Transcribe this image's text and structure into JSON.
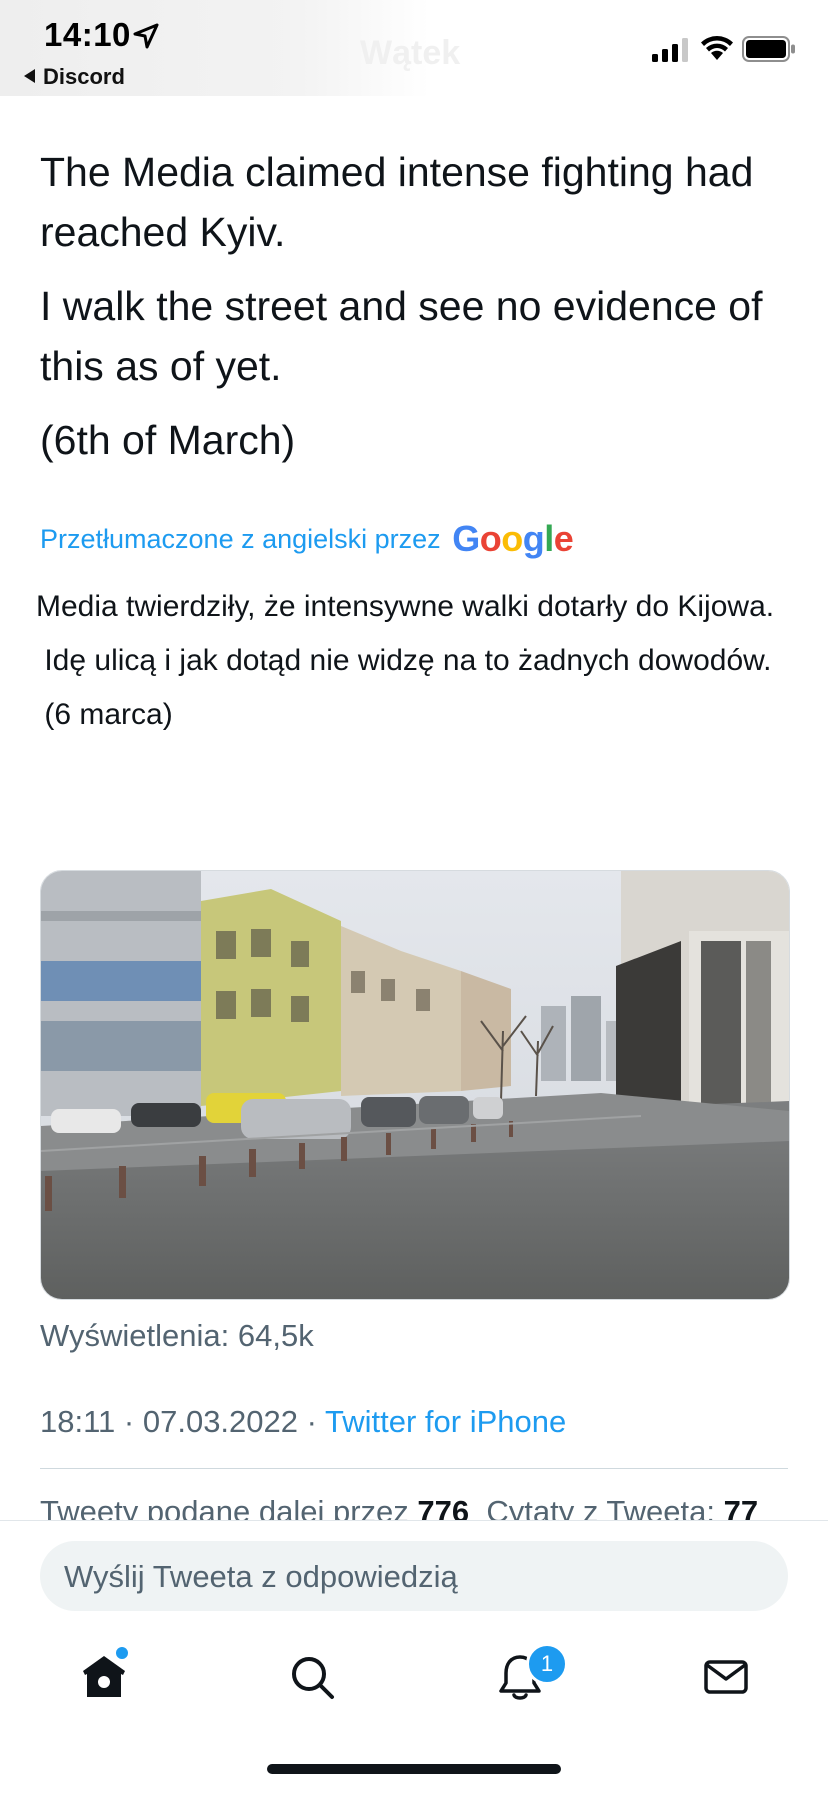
{
  "status_bar": {
    "time": "14:10",
    "back_app": "Discord",
    "nav_title": "Wątek"
  },
  "tweet": {
    "paragraphs": [
      "The Media claimed intense fighting had reached Kyiv.",
      "I walk the street and see no evidence of this as of yet.",
      "(6th of March)"
    ]
  },
  "translation": {
    "label": "Przetłumaczone z angielski przez",
    "brand_letters": [
      "G",
      "o",
      "o",
      "g",
      "l",
      "e"
    ],
    "paragraphs": [
      "Media twierdziły, że intensywne walki dotarły do Kijowa.",
      " Idę ulicą i jak dotąd nie widzę na to żadnych dowodów.",
      " (6 marca)"
    ]
  },
  "meta": {
    "views_label": "Wyświetlenia:",
    "views_value": "64,5k",
    "time": "18:11",
    "separator": "·",
    "date": "07.03.2022",
    "source": "Twitter for iPhone",
    "retweets_label": "Tweety podane dalej przez",
    "retweets_value": "776",
    "quotes_label": "Cytaty z Tweeta:",
    "quotes_value": "77"
  },
  "reply": {
    "placeholder": "Wyślij Tweeta z odpowiedzią"
  },
  "tabs": {
    "home": "home-icon",
    "search": "search-icon",
    "notifications": "bell-icon",
    "notifications_badge": "1",
    "messages": "mail-icon"
  },
  "colors": {
    "accent": "#1d9bf0",
    "text": "#0f1419",
    "secondary": "#536471",
    "reply_bg": "#eff3f4"
  }
}
